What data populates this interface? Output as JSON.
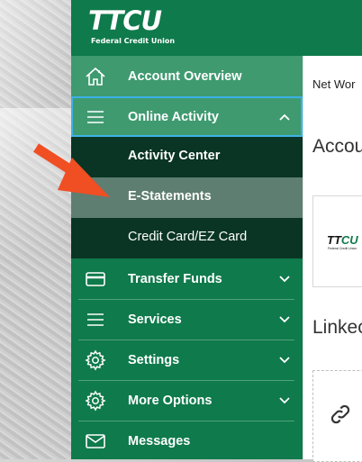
{
  "brand": {
    "logo_main": "TTCU",
    "logo_sub": "Federal Credit Union"
  },
  "sidebar": {
    "items": [
      {
        "label": "Account Overview",
        "icon": "home-icon"
      },
      {
        "label": "Online Activity",
        "icon": "menu-icon",
        "expanded": true
      },
      {
        "label": "Transfer Funds",
        "icon": "credit-card-icon"
      },
      {
        "label": "Services",
        "icon": "menu-icon"
      },
      {
        "label": "Settings",
        "icon": "gear-icon"
      },
      {
        "label": "More Options",
        "icon": "gear-icon"
      },
      {
        "label": "Messages",
        "icon": "mail-icon"
      }
    ],
    "sub_items": [
      {
        "label": "Activity Center"
      },
      {
        "label": "E-Statements",
        "active": true
      },
      {
        "label": "Credit Card/EZ Card"
      }
    ]
  },
  "content": {
    "net_worth_label": "Net Wor",
    "accounts_heading": "Accou",
    "linked_heading": "Linkec",
    "card_logo_main": "TTCU",
    "card_logo_sub": "Federal Credit Union"
  },
  "colors": {
    "sidebar_green": "#0f7a4b",
    "highlight_green": "#3f9a70",
    "submenu_dark": "#0a3524",
    "active_sub": "#5e7e71",
    "focus_border": "#3cb1e6",
    "arrow_orange": "#f04e23"
  }
}
